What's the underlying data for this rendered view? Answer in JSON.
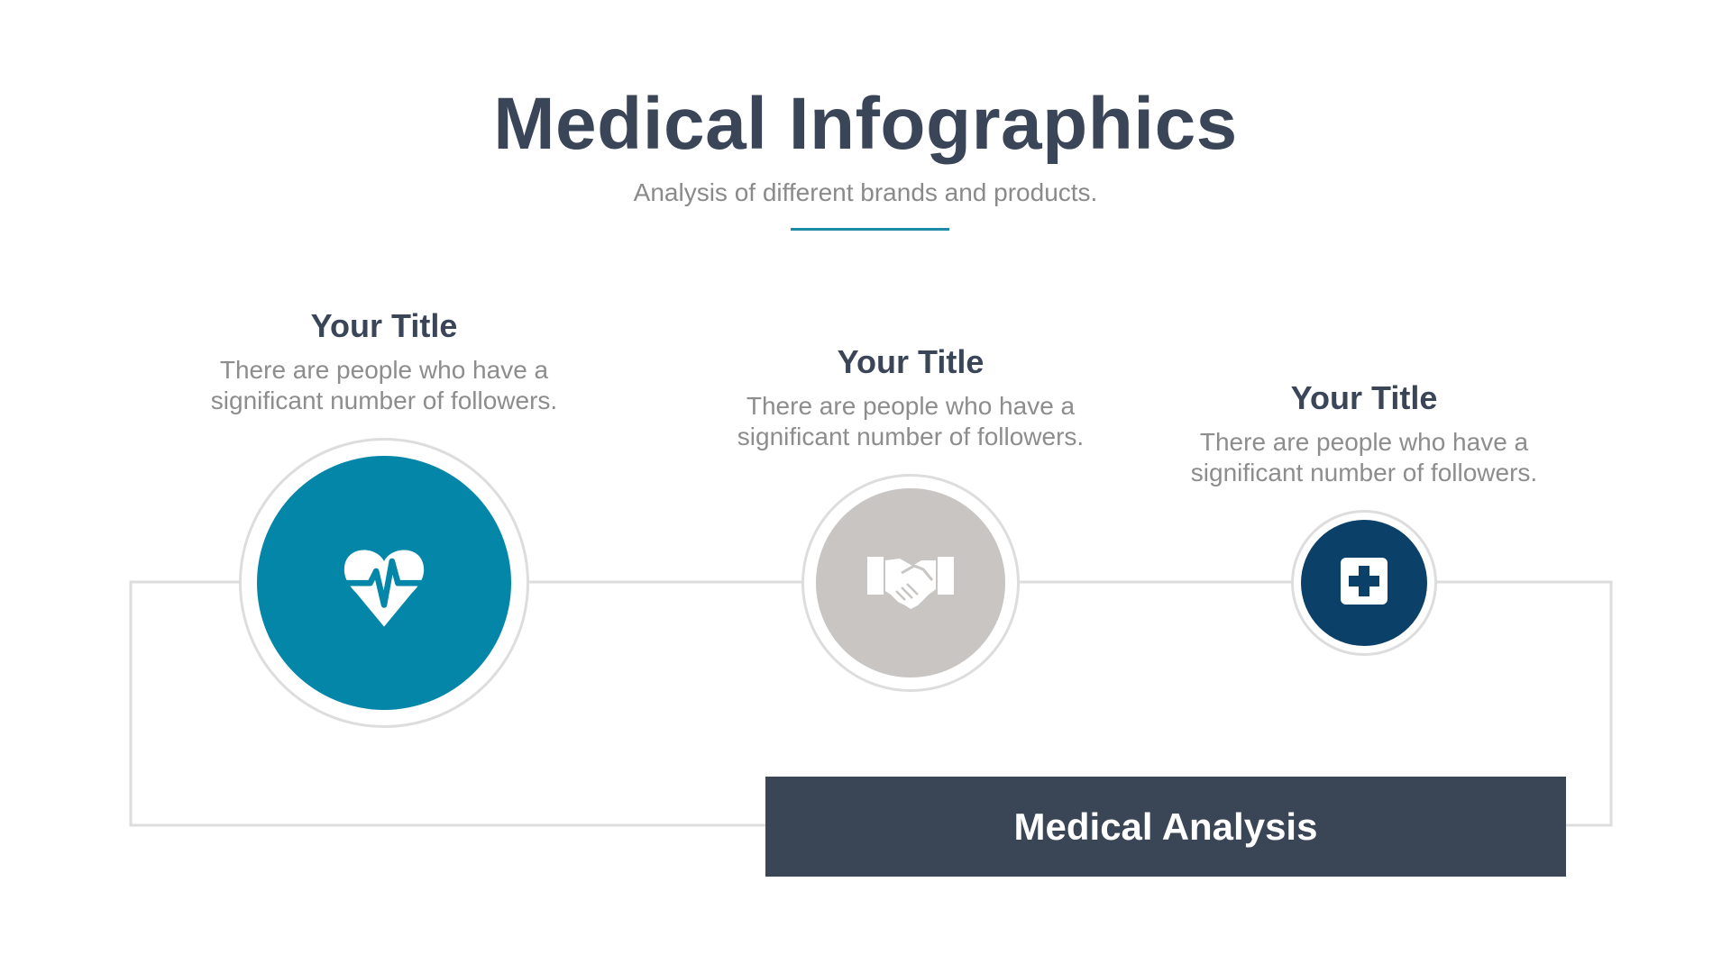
{
  "header": {
    "title": "Medical Infographics",
    "subtitle": "Analysis of different brands and products."
  },
  "steps": [
    {
      "title": "Your Title",
      "description_line1": "There are people who have a",
      "description_line2": "significant number of followers.",
      "icon": "heartbeat-heart-icon",
      "color": "#0386a8"
    },
    {
      "title": "Your Title",
      "description_line1": "There are people who have a",
      "description_line2": "significant number of followers.",
      "icon": "handshake-icon",
      "color": "#c8c5c3"
    },
    {
      "title": "Your Title",
      "description_line1": "There are people who have a",
      "description_line2": "significant number of followers.",
      "icon": "medical-cross-icon",
      "color": "#0b4068"
    }
  ],
  "banner": {
    "label": "Medical Analysis",
    "color": "#3a4555"
  },
  "colors": {
    "accent": "#1d8aa6",
    "heading": "#3a4557",
    "body_text": "#8d8d8d",
    "connector": "#dddddd"
  }
}
